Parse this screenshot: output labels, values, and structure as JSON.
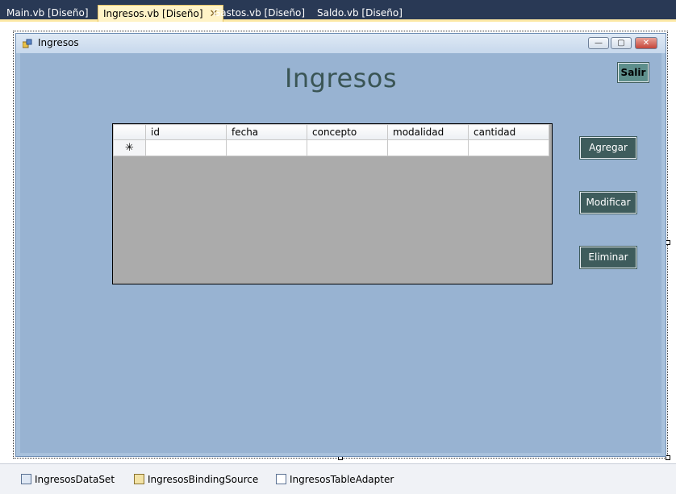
{
  "tabs": [
    {
      "label": "Main.vb [Diseño]"
    },
    {
      "label": "Ingresos.vb [Diseño]",
      "close": "✕"
    },
    {
      "label": "Gastos.vb [Diseño]"
    },
    {
      "label": "Saldo.vb [Diseño]"
    }
  ],
  "form": {
    "title": "Ingresos",
    "heading": "Ingresos",
    "buttons": {
      "salir": "Salir",
      "agregar": "Agregar",
      "modificar": "Modificar",
      "eliminar": "Eliminar"
    },
    "grid": {
      "columns": [
        "id",
        "fecha",
        "concepto",
        "modalidad",
        "cantidad"
      ],
      "new_row_marker": "✳"
    }
  },
  "tray": {
    "components": [
      {
        "label": "IngresosDataSet",
        "icon": "dataset-icon"
      },
      {
        "label": "IngresosBindingSource",
        "icon": "binding-source-icon"
      },
      {
        "label": "IngresosTableAdapter",
        "icon": "table-adapter-icon"
      }
    ]
  },
  "colors": {
    "form_background": "#98b3d2",
    "button": "#3e5c5c",
    "heading": "#3a5555"
  }
}
